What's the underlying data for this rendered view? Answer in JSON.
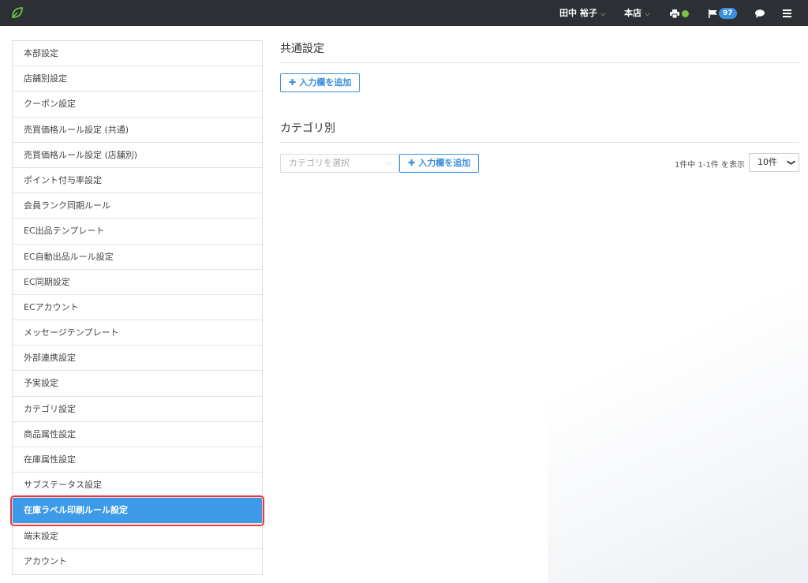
{
  "header": {
    "user_name": "田中 裕子",
    "store": "本店",
    "printer_status_color": "#7ec242",
    "notification_count": "97"
  },
  "sidebar": {
    "items": [
      {
        "label": "本部設定",
        "active": false
      },
      {
        "label": "店舗別設定",
        "active": false
      },
      {
        "label": "クーポン設定",
        "active": false
      },
      {
        "label": "売買価格ルール設定 (共通)",
        "active": false
      },
      {
        "label": "売買価格ルール設定 (店舗別)",
        "active": false
      },
      {
        "label": "ポイント付与率設定",
        "active": false
      },
      {
        "label": "会員ランク同期ルール",
        "active": false
      },
      {
        "label": "EC出品テンプレート",
        "active": false
      },
      {
        "label": "EC自動出品ルール設定",
        "active": false
      },
      {
        "label": "EC同期設定",
        "active": false
      },
      {
        "label": "ECアカウント",
        "active": false
      },
      {
        "label": "メッセージテンプレート",
        "active": false
      },
      {
        "label": "外部連携設定",
        "active": false
      },
      {
        "label": "予実設定",
        "active": false
      },
      {
        "label": "カテゴリ設定",
        "active": false
      },
      {
        "label": "商品属性設定",
        "active": false
      },
      {
        "label": "在庫属性設定",
        "active": false
      },
      {
        "label": "サブステータス設定",
        "active": false
      },
      {
        "label": "在庫ラベル印刷ルール設定",
        "active": true
      },
      {
        "label": "端末設定",
        "active": false
      },
      {
        "label": "アカウント",
        "active": false
      }
    ]
  },
  "main": {
    "common_section": {
      "title": "共通設定",
      "add_button": "入力欄を追加"
    },
    "category_section": {
      "title": "カテゴリ別",
      "select_placeholder": "カテゴリを選択",
      "add_button": "入力欄を追加",
      "count_text": "1件中 1-1件 を表示",
      "page_size": "10件"
    }
  },
  "colors": {
    "accent": "#3d8fe0",
    "active_item": "#3d9ae8",
    "highlight_outline": "#e8383d",
    "topbar": "#2c2f33"
  }
}
